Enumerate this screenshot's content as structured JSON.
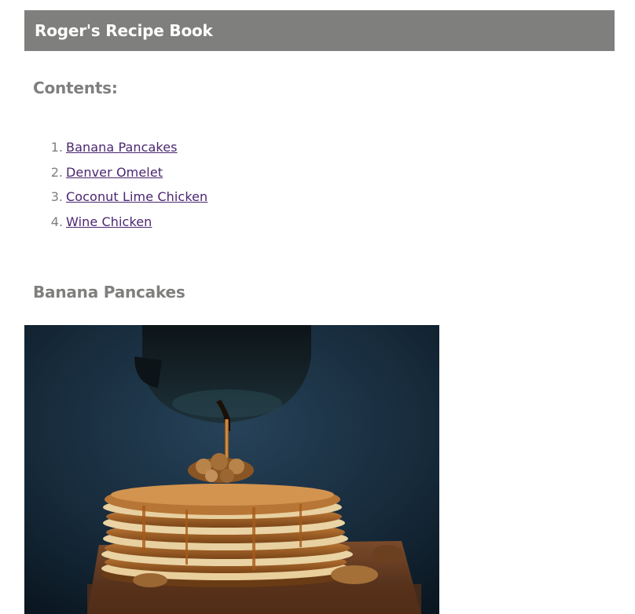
{
  "header": {
    "title": "Roger's Recipe Book"
  },
  "contents": {
    "heading": "Contents:",
    "items": [
      {
        "number": "1.",
        "label": "Banana Pancakes"
      },
      {
        "number": "2.",
        "label": "Denver Omelet"
      },
      {
        "number": "3.",
        "label": "Coconut Lime Chicken"
      },
      {
        "number": "4.",
        "label": "Wine Chicken"
      }
    ]
  },
  "section": {
    "heading": "Banana Pancakes"
  },
  "colors": {
    "header_bg": "#7f7f7e",
    "heading_text": "#7f7f7e",
    "link": "#4b2670"
  }
}
